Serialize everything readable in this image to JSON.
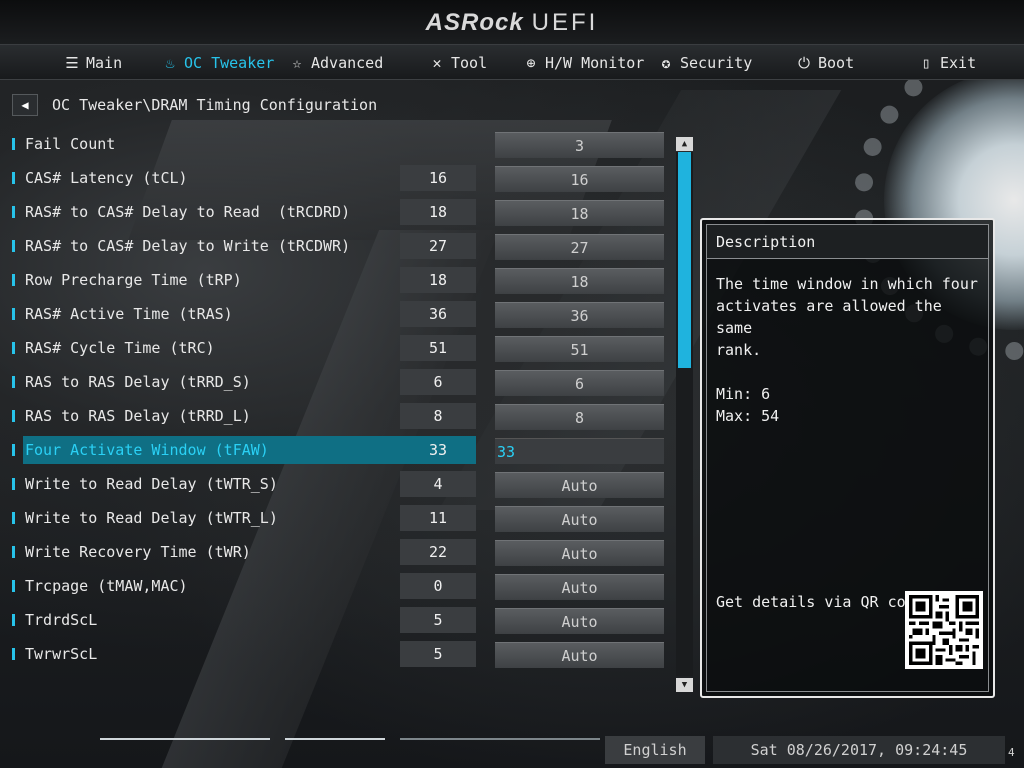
{
  "header": {
    "brand": "ASRock",
    "product": "UEFI"
  },
  "tabs": [
    {
      "label": "Main",
      "icon": "list-icon",
      "active": false
    },
    {
      "label": "OC Tweaker",
      "icon": "flame-icon",
      "active": true
    },
    {
      "label": "Advanced",
      "icon": "star-icon",
      "active": false
    },
    {
      "label": "Tool",
      "icon": "tools-icon",
      "active": false
    },
    {
      "label": "H/W Monitor",
      "icon": "crosshair-icon",
      "active": false
    },
    {
      "label": "Security",
      "icon": "shield-icon",
      "active": false
    },
    {
      "label": "Boot",
      "icon": "power-icon",
      "active": false
    },
    {
      "label": "Exit",
      "icon": "exit-door-icon",
      "active": false
    }
  ],
  "breadcrumb": "OC Tweaker\\DRAM Timing Configuration",
  "rows": [
    {
      "label": "Fail Count",
      "current": "",
      "value": "3",
      "selected": false
    },
    {
      "label": "CAS# Latency (tCL)",
      "current": "16",
      "value": "16",
      "selected": false
    },
    {
      "label": "RAS# to CAS# Delay to Read  (tRCDRD)",
      "current": "18",
      "value": "18",
      "selected": false
    },
    {
      "label": "RAS# to CAS# Delay to Write (tRCDWR)",
      "current": "27",
      "value": "27",
      "selected": false
    },
    {
      "label": "Row Precharge Time (tRP)",
      "current": "18",
      "value": "18",
      "selected": false
    },
    {
      "label": "RAS# Active Time (tRAS)",
      "current": "36",
      "value": "36",
      "selected": false
    },
    {
      "label": "RAS# Cycle Time (tRC)",
      "current": "51",
      "value": "51",
      "selected": false
    },
    {
      "label": "RAS to RAS Delay (tRRD_S)",
      "current": "6",
      "value": "6",
      "selected": false
    },
    {
      "label": "RAS to RAS Delay (tRRD_L)",
      "current": "8",
      "value": "8",
      "selected": false
    },
    {
      "label": "Four Activate Window (tFAW)",
      "current": "33",
      "value": "33",
      "selected": true
    },
    {
      "label": "Write to Read Delay (tWTR_S)",
      "current": "4",
      "value": "Auto",
      "selected": false
    },
    {
      "label": "Write to Read Delay (tWTR_L)",
      "current": "11",
      "value": "Auto",
      "selected": false
    },
    {
      "label": "Write Recovery Time (tWR)",
      "current": "22",
      "value": "Auto",
      "selected": false
    },
    {
      "label": "Trcpage (tMAW,MAC)",
      "current": "0",
      "value": "Auto",
      "selected": false
    },
    {
      "label": "TrdrdScL",
      "current": "5",
      "value": "Auto",
      "selected": false
    },
    {
      "label": "TwrwrScL",
      "current": "5",
      "value": "Auto",
      "selected": false
    }
  ],
  "description": {
    "title": "Description",
    "text": "The time window in which four\nactivates are allowed the same\nrank.\n\nMin: 6\nMax: 54",
    "qr_label": "Get details via QR code"
  },
  "footer": {
    "language": "English",
    "datetime": "Sat 08/26/2017, 09:24:45",
    "page": "4"
  },
  "colors": {
    "accent": "#27c3ea",
    "selected_row": "#0f6f84",
    "scroll_thumb": "#1fb3de"
  }
}
